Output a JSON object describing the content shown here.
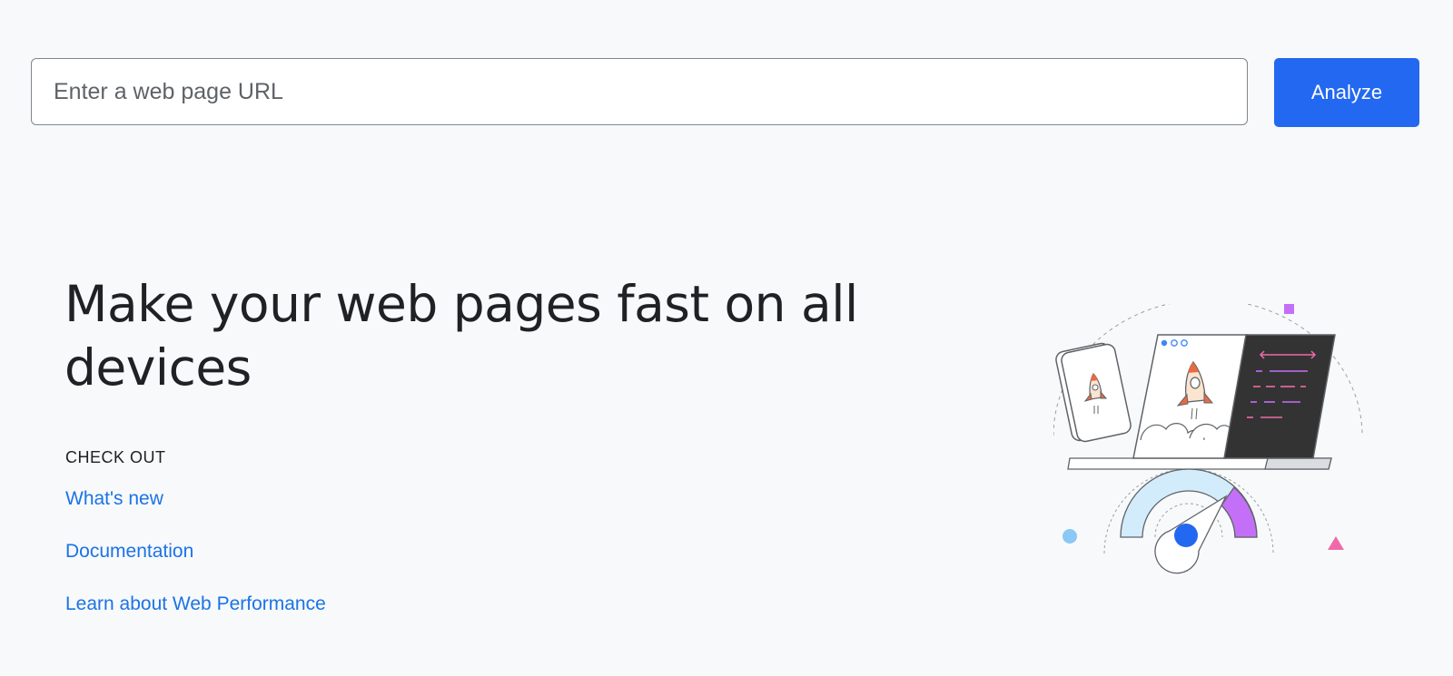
{
  "search": {
    "placeholder": "Enter a web page URL",
    "value": "",
    "analyze_label": "Analyze"
  },
  "hero": {
    "title": "Make your web pages fast on all devices"
  },
  "check_out": {
    "heading": "CHECK OUT",
    "links": [
      {
        "label": "What's new"
      },
      {
        "label": "Documentation"
      },
      {
        "label": "Learn about Web Performance"
      }
    ]
  },
  "illustration": {
    "icon": "speed-illustration",
    "colors": {
      "accent_blue": "#2368f0",
      "purple": "#c46ff7",
      "pink": "#f06aa8",
      "light_blue": "#d3ecfb",
      "dark_panel": "#333333",
      "rocket_orange": "#e96a42"
    }
  }
}
